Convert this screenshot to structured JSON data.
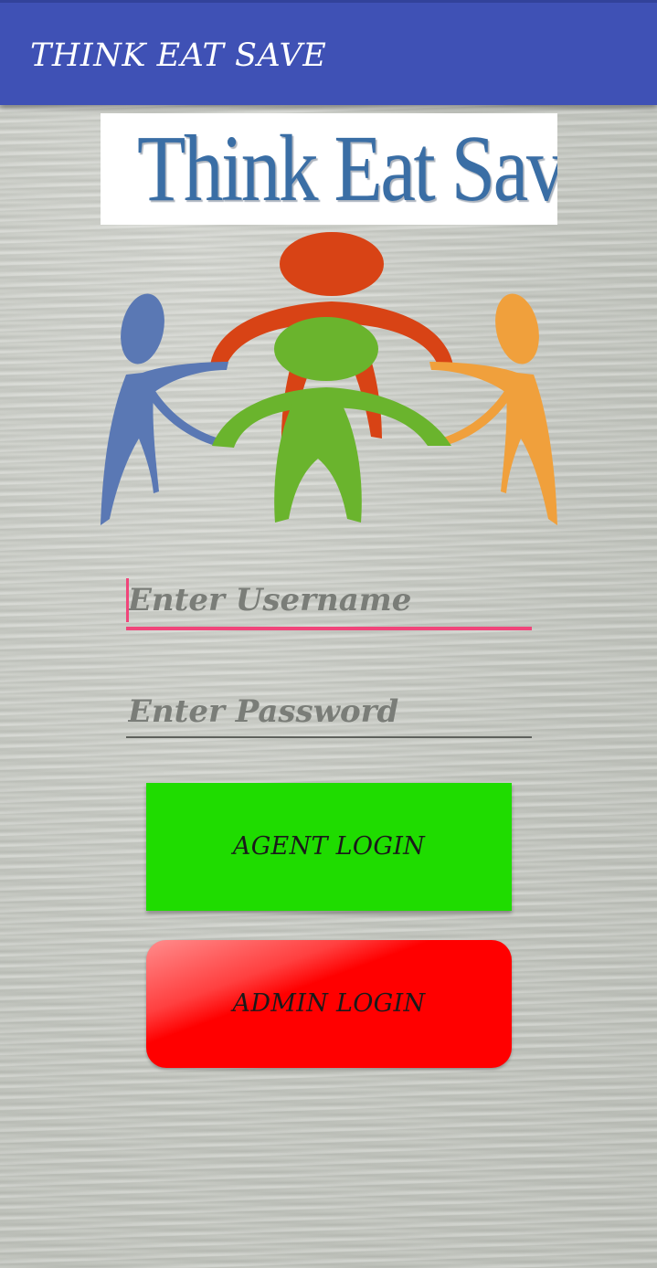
{
  "app_bar": {
    "title": "THINK EAT SAVE",
    "color": "#3f51b5"
  },
  "logo": {
    "banner_text": "Think Eat Save",
    "text_color": "#3a6ea5",
    "figures": [
      {
        "name": "blue-figure",
        "color": "#5a78b4"
      },
      {
        "name": "red-figure",
        "color": "#d84315"
      },
      {
        "name": "green-figure",
        "color": "#6ab42d"
      },
      {
        "name": "orange-figure",
        "color": "#f0a03c"
      }
    ]
  },
  "login_form": {
    "username": {
      "placeholder": "Enter Username",
      "value": "",
      "focused": true,
      "accent": "#f0457a"
    },
    "password": {
      "placeholder": "Enter Password",
      "value": ""
    }
  },
  "buttons": {
    "agent_login": {
      "label": "AGENT LOGIN",
      "color": "#1fdc00"
    },
    "admin_login": {
      "label": "ADMIN LOGIN",
      "color": "#ff0000"
    }
  }
}
